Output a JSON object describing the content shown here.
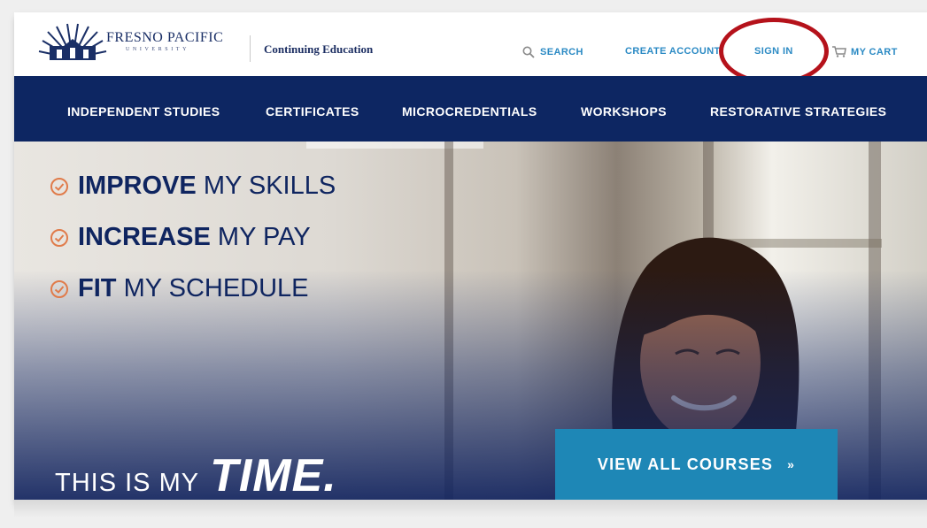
{
  "brand": {
    "name": "FRESNO PACIFIC",
    "sub": "UNIVERSITY",
    "division": "Continuing Education"
  },
  "toplinks": {
    "search": "SEARCH",
    "create_account": "CREATE ACCOUNT",
    "sign_in": "SIGN IN",
    "cart": "MY CART"
  },
  "nav": [
    {
      "label": "INDEPENDENT STUDIES"
    },
    {
      "label": "CERTIFICATES"
    },
    {
      "label": "MICROCREDENTIALS"
    },
    {
      "label": "WORKSHOPS"
    },
    {
      "label": "RESTORATIVE STRATEGIES"
    }
  ],
  "hero": {
    "goals": [
      {
        "bold": "IMPROVE",
        "rest": "MY SKILLS"
      },
      {
        "bold": "INCREASE",
        "rest": "MY PAY"
      },
      {
        "bold": "FIT",
        "rest": "MY SCHEDULE"
      }
    ],
    "tagline_a": "THIS IS MY",
    "tagline_b": "TIME.",
    "cta": "VIEW ALL COURSES",
    "cta_arrow": "»"
  },
  "colors": {
    "navy": "#0d2662",
    "accent_blue": "#2b8ac4",
    "cta_blue": "#1e87b6",
    "check_orange": "#e07b4a",
    "highlight_red": "#b5121b"
  },
  "icons": [
    "logo-sunburst-icon",
    "search-icon",
    "cart-icon",
    "check-circle-icon"
  ]
}
